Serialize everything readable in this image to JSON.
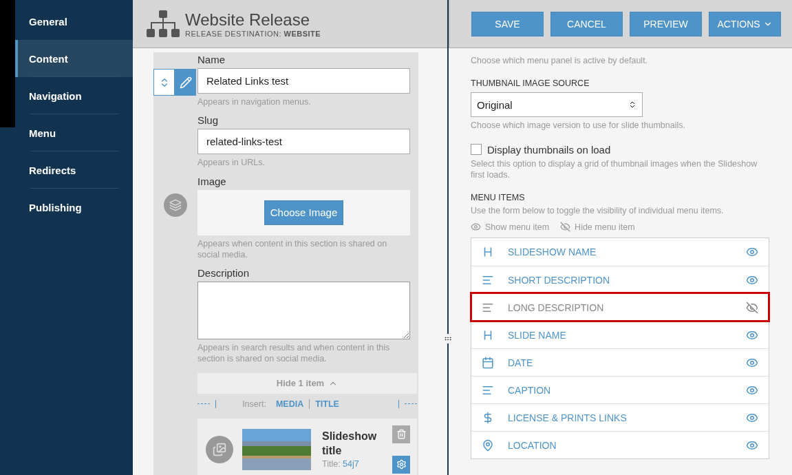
{
  "sidebar": {
    "items": [
      {
        "label": "General",
        "selected": false
      },
      {
        "label": "Content",
        "selected": true
      },
      {
        "label": "Navigation",
        "selected": false
      },
      {
        "label": "Menu",
        "selected": false
      },
      {
        "label": "Redirects",
        "selected": false
      },
      {
        "label": "Publishing",
        "selected": false
      }
    ]
  },
  "release": {
    "title": "Website Release",
    "destination_label": "RELEASE DESTINATION:",
    "destination_value": "WEBSITE"
  },
  "editor": {
    "name": {
      "label": "Name",
      "value": "Related Links test",
      "hint": "Appears in navigation menus."
    },
    "slug": {
      "label": "Slug",
      "value": "related-links-test",
      "hint": "Appears in URLs."
    },
    "image": {
      "label": "Image",
      "button": "Choose Image",
      "hint": "Appears when content in this section is shared on social media."
    },
    "description": {
      "label": "Description",
      "hint": "Appears in search results and when content in this section is shared on social media."
    },
    "collapse": {
      "label": "Hide 1 item",
      "expanded": true
    },
    "insert": {
      "label": "Insert:",
      "links": [
        "MEDIA",
        "TITLE"
      ]
    },
    "slide": {
      "title": "Slideshow title",
      "meta_label": "Title:",
      "meta_value": "54j7"
    }
  },
  "toolbar": {
    "buttons": [
      {
        "label": "SAVE",
        "kind": "plain"
      },
      {
        "label": "CANCEL",
        "kind": "plain"
      },
      {
        "label": "PREVIEW",
        "kind": "plain"
      },
      {
        "label": "ACTIONS",
        "kind": "dropdown"
      }
    ]
  },
  "settings": {
    "intro_hint": "Choose which menu panel is active by default.",
    "thumbnail_source": {
      "label": "THUMBNAIL IMAGE SOURCE",
      "value": "Original",
      "hint": "Choose which image version to use for slide thumbnails."
    },
    "display_thumbnails": {
      "label": "Display thumbnails on load",
      "checked": false,
      "hint": "Select this option to display a grid of thumbnail images when the Slideshow first loads."
    },
    "menu_items": {
      "label": "MENU ITEMS",
      "hint": "Use the form below to toggle the visibility of individual menu items.",
      "legend": [
        {
          "label": "Show menu item",
          "kind": "show"
        },
        {
          "label": "Hide menu item",
          "kind": "hide"
        }
      ],
      "items": [
        {
          "label": "SLIDESHOW NAME",
          "kind": "heading",
          "visible": true,
          "highlighted": false
        },
        {
          "label": "SHORT DESCRIPTION",
          "kind": "text",
          "visible": true,
          "highlighted": false
        },
        {
          "label": "LONG DESCRIPTION",
          "kind": "text",
          "visible": false,
          "highlighted": true
        },
        {
          "label": "SLIDE NAME",
          "kind": "heading",
          "visible": true,
          "highlighted": false
        },
        {
          "label": "DATE",
          "kind": "date",
          "visible": true,
          "highlighted": false
        },
        {
          "label": "CAPTION",
          "kind": "text",
          "visible": true,
          "highlighted": false
        },
        {
          "label": "LICENSE & PRINTS LINKS",
          "kind": "price",
          "visible": true,
          "highlighted": false
        },
        {
          "label": "LOCATION",
          "kind": "location",
          "visible": true,
          "highlighted": false
        }
      ]
    }
  }
}
